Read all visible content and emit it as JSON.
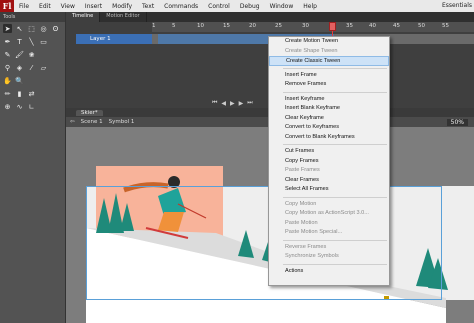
{
  "app": {
    "logo": "Fl",
    "workspace": "Essentials",
    "menu": [
      "File",
      "Edit",
      "View",
      "Insert",
      "Modify",
      "Text",
      "Commands",
      "Control",
      "Debug",
      "Window",
      "Help"
    ]
  },
  "tools": {
    "panel_title": "Tools"
  },
  "timeline": {
    "tabs": [
      "Timeline",
      "Motion Editor"
    ],
    "layer_name": "Layer 1",
    "frame_numbers": [
      "1",
      "5",
      "10",
      "15",
      "20",
      "25",
      "30",
      "35",
      "40",
      "45",
      "50",
      "55",
      "60",
      "65",
      "70"
    ]
  },
  "stage": {
    "doc_tab": "Skier*",
    "breadcrumb_scene": "Scene 1",
    "breadcrumb_symbol": "Symbol 1",
    "zoom": "50%"
  },
  "context_menu": {
    "groups": [
      [
        {
          "label": "Create Motion Tween",
          "enabled": true,
          "highlight": false
        },
        {
          "label": "Create Shape Tween",
          "enabled": false,
          "highlight": false
        },
        {
          "label": "Create Classic Tween",
          "enabled": true,
          "highlight": true
        }
      ],
      [
        {
          "label": "Insert Frame",
          "enabled": true,
          "highlight": false
        },
        {
          "label": "Remove Frames",
          "enabled": true,
          "highlight": false
        }
      ],
      [
        {
          "label": "Insert Keyframe",
          "enabled": true,
          "highlight": false
        },
        {
          "label": "Insert Blank Keyframe",
          "enabled": true,
          "highlight": false
        },
        {
          "label": "Clear Keyframe",
          "enabled": true,
          "highlight": false
        },
        {
          "label": "Convert to Keyframes",
          "enabled": true,
          "highlight": false
        },
        {
          "label": "Convert to Blank Keyframes",
          "enabled": true,
          "highlight": false
        }
      ],
      [
        {
          "label": "Cut Frames",
          "enabled": true,
          "highlight": false
        },
        {
          "label": "Copy Frames",
          "enabled": true,
          "highlight": false
        },
        {
          "label": "Paste Frames",
          "enabled": false,
          "highlight": false
        },
        {
          "label": "Clear Frames",
          "enabled": true,
          "highlight": false
        },
        {
          "label": "Select All Frames",
          "enabled": true,
          "highlight": false
        }
      ],
      [
        {
          "label": "Copy Motion",
          "enabled": false,
          "highlight": false
        },
        {
          "label": "Copy Motion as ActionScript 3.0...",
          "enabled": false,
          "highlight": false
        },
        {
          "label": "Paste Motion",
          "enabled": false,
          "highlight": false
        },
        {
          "label": "Paste Motion Special...",
          "enabled": false,
          "highlight": false
        }
      ],
      [
        {
          "label": "Reverse Frames",
          "enabled": false,
          "highlight": false
        },
        {
          "label": "Synchronize Symbols",
          "enabled": false,
          "highlight": false
        }
      ],
      [
        {
          "label": "Actions",
          "enabled": true,
          "highlight": false
        }
      ]
    ]
  },
  "colors": {
    "accent_highlight": "#cde2f7",
    "layer_selected": "#3b6fb5",
    "playhead": "#e23b3b",
    "sun_box": "#f8b39a",
    "tree": "#1f8a7a",
    "skier_jacket": "#1fa39a",
    "skier_pants": "#f0913a",
    "hair": "#c8642a"
  }
}
